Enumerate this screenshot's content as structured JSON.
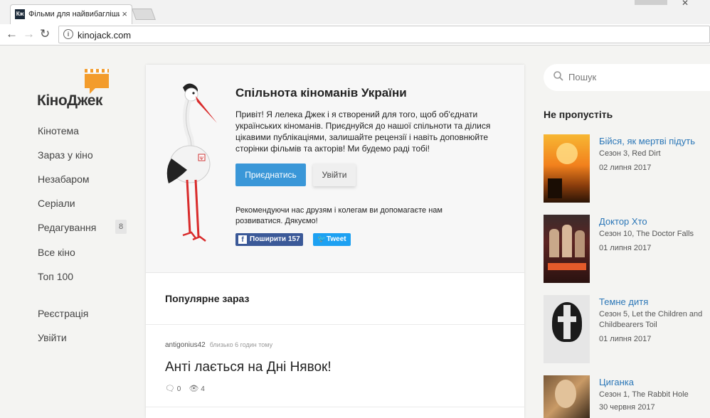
{
  "browser": {
    "tab_title": "Фільми для найвибагліших",
    "favicon_text": "Кж",
    "url": "kinojack.com"
  },
  "sidebar": {
    "logo_text": "КіноДжек",
    "items": [
      {
        "label": "Кінотема"
      },
      {
        "label": "Зараз у кіно"
      },
      {
        "label": "Незабаром"
      },
      {
        "label": "Серіали"
      },
      {
        "label": "Редагування",
        "badge": "8"
      },
      {
        "label": "Все кіно"
      },
      {
        "label": "Топ 100"
      },
      {
        "label": "Реєстрація"
      },
      {
        "label": "Увійти"
      }
    ]
  },
  "welcome": {
    "title": "Спільнота кіноманів України",
    "text": "Привіт! Я лелека Джек і я створений для того, щоб об'єднати українських кіноманів. Приєднуйся до нашої спільноти та ділися цікавими публікаціями, залишайте рецензії і навіть доповнюйте сторінки фільмів та акторів! Ми будемо раді тобі!",
    "join_label": "Приєднатись",
    "login_label": "Увійти",
    "recommend_text": "Рекомендуючи нас друзям і колегам ви допомагаєте нам розвиватися. Дякуємо!",
    "share_label": "Поширити",
    "share_count": "157",
    "tweet_label": "Tweet"
  },
  "popular": {
    "title": "Популярне зараз",
    "post": {
      "author": "antigonius42",
      "time": "близько 6 годин тому",
      "title": "Анті лається на Дні Нявок!",
      "comments": "0",
      "views": "4"
    }
  },
  "right": {
    "search_placeholder": "Пошук",
    "heading": "Не пропустіть",
    "movies": [
      {
        "title": "Бійся, як мертві підуть",
        "subtitle": "Сезон 3, Red Dirt",
        "date": "02 липня 2017"
      },
      {
        "title": "Доктор Хто",
        "subtitle": "Сезон 10, The Doctor Falls",
        "date": "01 липня 2017"
      },
      {
        "title": "Темне дитя",
        "subtitle": "Сезон 5, Let the Children and Childbearers Toil",
        "date": "01 липня 2017"
      },
      {
        "title": "Циганка",
        "subtitle": "Сезон 1, The Rabbit Hole",
        "date": "30 червня 2017"
      }
    ]
  },
  "colors": {
    "accent": "#3a97d8",
    "link": "#2a76b7",
    "logo_orange": "#f39c2c",
    "facebook": "#3b5998",
    "twitter": "#1da1f2"
  }
}
